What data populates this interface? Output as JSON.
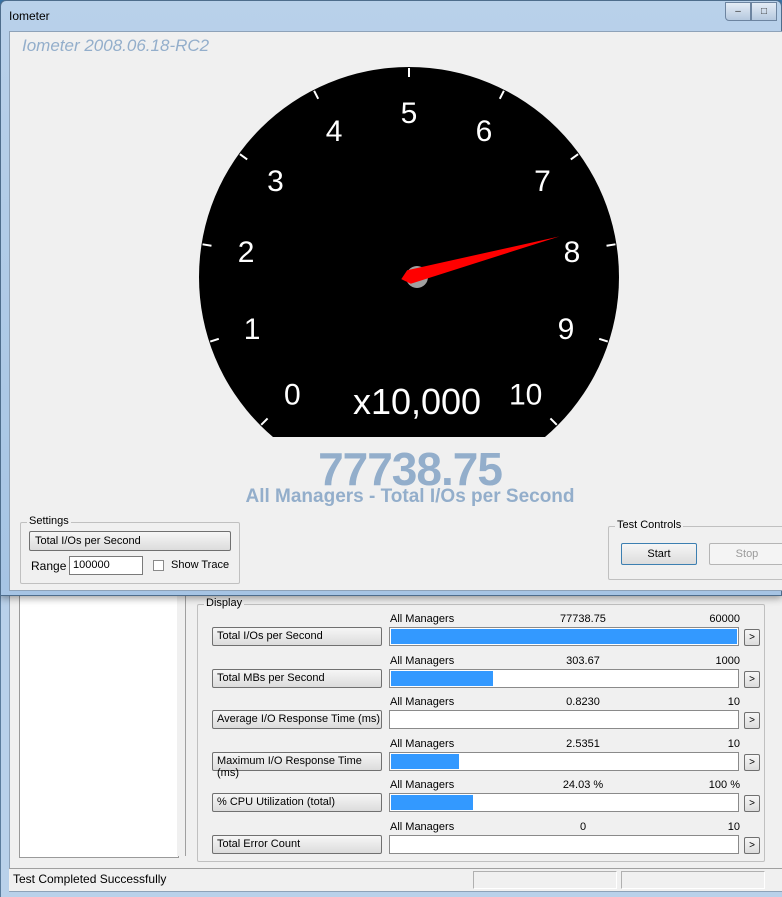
{
  "window": {
    "title": "Iometer",
    "version": "Iometer 2008.06.18-RC2",
    "controls": {
      "minimize": "–",
      "maximize": "□",
      "close": "✕"
    }
  },
  "gauge": {
    "value": 77738.75,
    "value_text": "77738.75",
    "metric_label": "All Managers - Total I/Os per Second",
    "multiplier": "x10,000",
    "range": 100000,
    "tick_labels": [
      "0",
      "1",
      "2",
      "3",
      "4",
      "5",
      "6",
      "7",
      "8",
      "9",
      "10"
    ],
    "needle_color": "#ff0000",
    "face_color": "#000000"
  },
  "settings": {
    "title": "Settings",
    "metric_button": "Total I/Os per Second",
    "range_label": "Range",
    "range_value": "100000",
    "show_trace_label": "Show Trace",
    "show_trace_checked": false
  },
  "test_controls": {
    "title": "Test Controls",
    "start": "Start",
    "stop": "Stop"
  },
  "display": {
    "title": "Display",
    "arrow": ">",
    "rows": [
      {
        "button": "Total I/Os per Second",
        "manager": "All Managers",
        "value": "77738.75",
        "max": "60000",
        "fill": 1.0
      },
      {
        "button": "Total MBs per Second",
        "manager": "All Managers",
        "value": "303.67",
        "max": "1000",
        "fill": 0.3
      },
      {
        "button": "Average I/O Response Time (ms)",
        "manager": "All Managers",
        "value": "0.8230",
        "max": "10",
        "fill": 0.0
      },
      {
        "button": "Maximum I/O Response Time (ms)",
        "manager": "All Managers",
        "value": "2.5351",
        "max": "10",
        "fill": 0.2
      },
      {
        "button": "% CPU Utilization (total)",
        "manager": "All Managers",
        "value": "24.03 %",
        "max": "100 %",
        "fill": 0.24
      },
      {
        "button": "Total Error Count",
        "manager": "All Managers",
        "value": "0",
        "max": "10",
        "fill": 0.0
      }
    ]
  },
  "status": {
    "text": "Test Completed Successfully"
  }
}
